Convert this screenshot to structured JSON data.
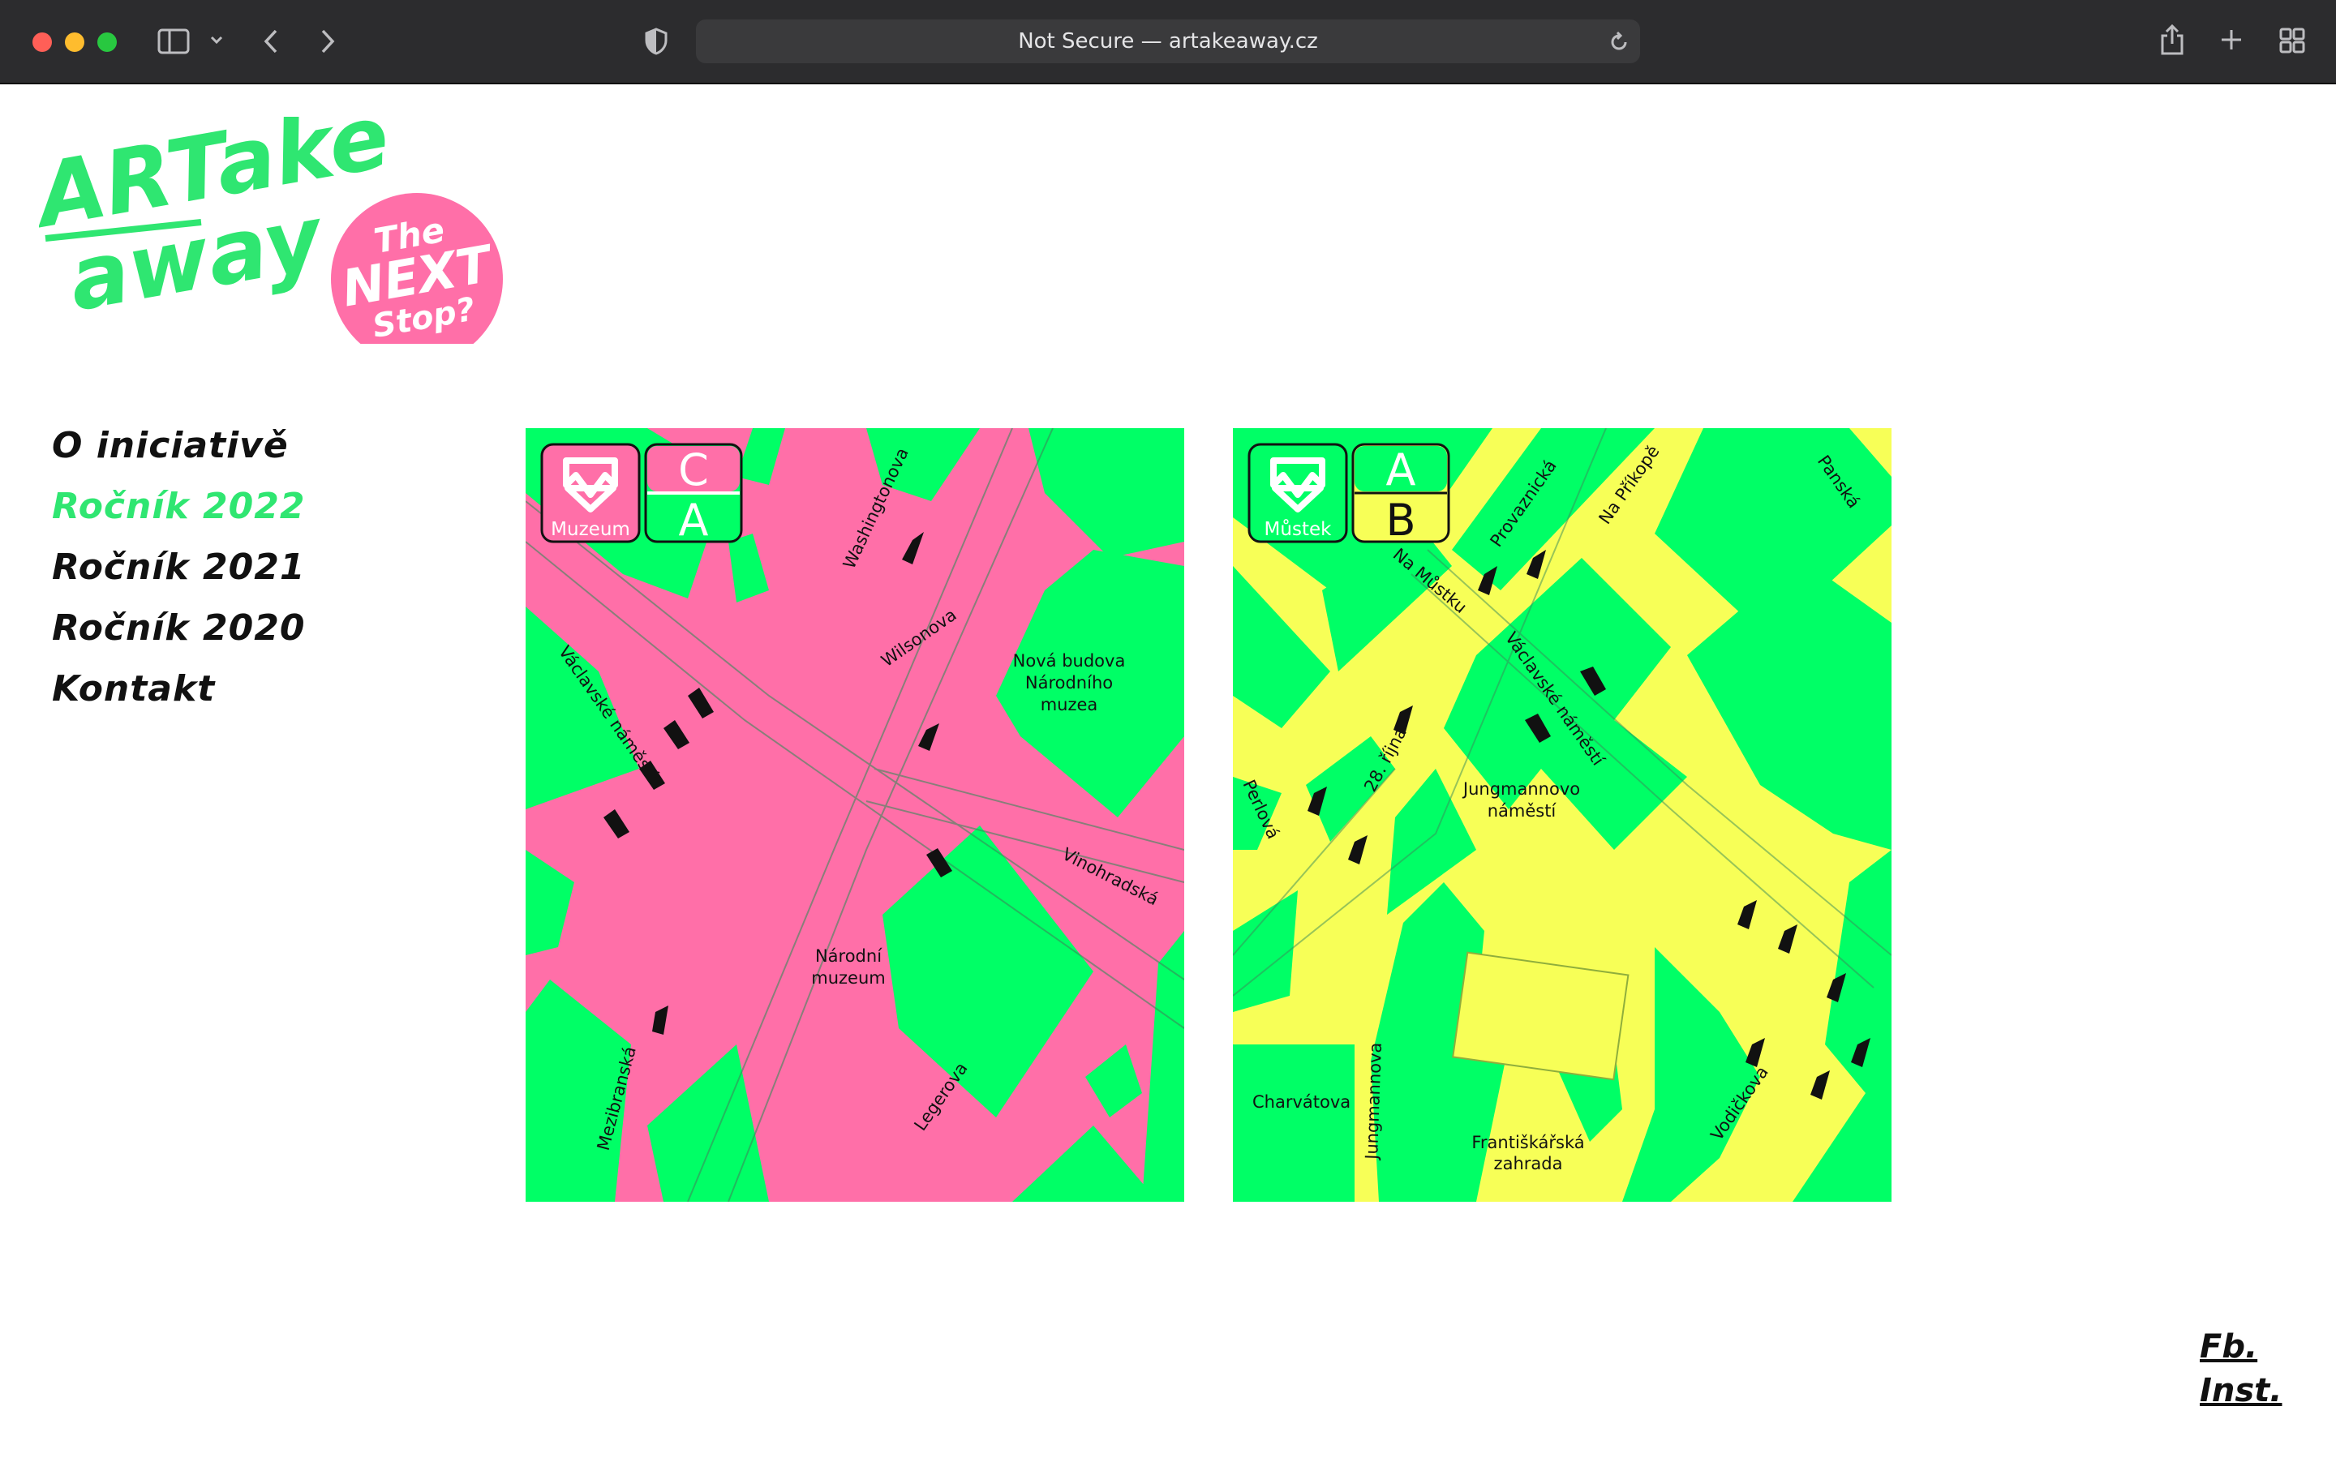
{
  "browser": {
    "url_text": "Not Secure — artakeaway.cz"
  },
  "logo": {
    "line1": "ARTake",
    "line2": "away",
    "badge_line1": "The",
    "badge_line2": "NEXT",
    "badge_line3": "Stop?"
  },
  "nav": {
    "items": [
      {
        "label": "O iniciativě"
      },
      {
        "label": "Ročník 2022"
      },
      {
        "label": "Ročník 2021"
      },
      {
        "label": "Ročník 2020"
      },
      {
        "label": "Kontakt"
      }
    ]
  },
  "maps": {
    "muzeum": {
      "station": "Muzeum",
      "line_top": "C",
      "line_bottom": "A",
      "labels": {
        "washingtonova": "Washingtonova",
        "wilsonova": "Wilsonova",
        "vaclavske": "Václavské náměstí",
        "nova_budova_1": "Nová budova",
        "nova_budova_2": "Národního",
        "nova_budova_3": "muzea",
        "vinohradska": "Vinohradská",
        "narodni_1": "Národní",
        "narodni_2": "muzeum",
        "mezibranska": "Mezibranská",
        "legerova": "Legerova"
      },
      "colors": {
        "bg": "#ff6fa8",
        "block": "#00ff66"
      }
    },
    "mustek": {
      "station": "Můstek",
      "line_top": "A",
      "line_bottom": "B",
      "labels": {
        "provaznicka": "Provaznická",
        "na_prikope": "Na Příkopě",
        "panska": "Panská",
        "na_mustku": "Na Můstku",
        "vaclavske": "Václavské náměstí",
        "rijna": "28. října",
        "jungmannovo_1": "Jungmannovo",
        "jungmannovo_2": "náměstí",
        "perlova": "Perlová",
        "charvatova": "Charvátova",
        "jungmannova": "Jungmannova",
        "frantiskanska_1": "Františkářská",
        "frantiskanska_2": "zahrada",
        "vodickova": "Vodičkova"
      },
      "colors": {
        "bg": "#00ff66",
        "road": "#f7ff57"
      }
    }
  },
  "social": {
    "fb": "Fb.",
    "inst": "Inst."
  },
  "colors": {
    "accent_green": "#2fe671",
    "accent_pink": "#ff6fa8"
  }
}
